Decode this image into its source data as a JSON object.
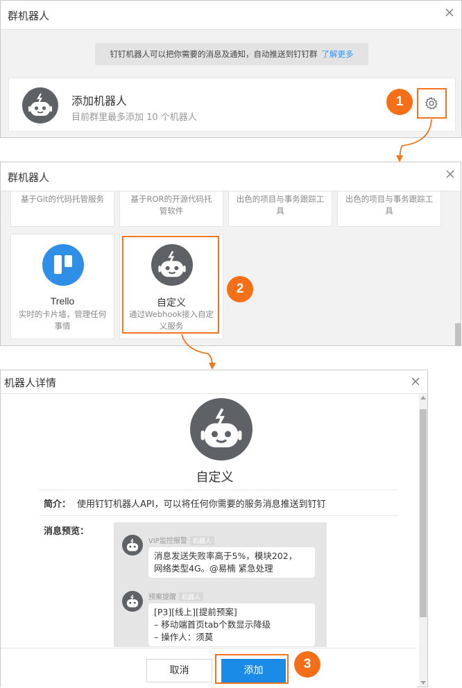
{
  "panel1": {
    "title": "群机器人",
    "notice_text": "钉钉机器人可以把你需要的消息及通知，自动推送到钉钉群",
    "notice_link": "了解更多",
    "add_robot_title": "添加机器人",
    "add_robot_sub": "目前群里最多添加 10 个机器人",
    "step_badge": "1"
  },
  "panel2": {
    "title": "群机器人",
    "top_cards": [
      {
        "desc": "基于Git的代码托管服务"
      },
      {
        "desc": "基于ROR的开源代码托管软件"
      },
      {
        "desc": "出色的项目与事务跟踪工具"
      },
      {
        "desc": "出色的项目与事务跟踪工具"
      }
    ],
    "trello": {
      "title": "Trello",
      "desc": "实时的卡片墙，管理任何事情"
    },
    "custom": {
      "title": "自定义",
      "desc": "通过Webhook接入自定义服务"
    },
    "step_badge": "2"
  },
  "panel3": {
    "title": "机器人详情",
    "robot_name": "自定义",
    "intro_label": "简介：",
    "intro_text": "使用钉钉机器人API，可以将任何你需要的服务消息推送到钉钉",
    "preview_label": "消息预览：",
    "messages": [
      {
        "name": "VIP监控报警",
        "tag": "机器人",
        "lines": [
          "消息发送失败率高于5%，模块202，",
          "网络类型4G。@易楠 紧急处理"
        ]
      },
      {
        "name": "预案提醒",
        "tag": "机器人",
        "lines": [
          "[P3][线上][提前预案]",
          "– 移动端首页tab个数显示降级",
          "– 操作人：须莫"
        ]
      }
    ],
    "cancel_label": "取消",
    "add_label": "添加",
    "step_badge": "3"
  },
  "colors": {
    "accent_orange": "#f2731b",
    "primary_blue": "#1a8ce8",
    "trello_blue": "#2f8ee6",
    "robot_gray": "#5e6166"
  }
}
